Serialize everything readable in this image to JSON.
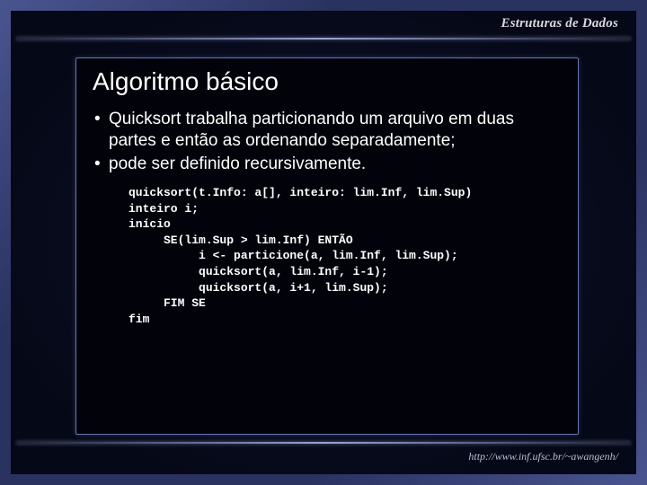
{
  "header": {
    "course": "Estruturas de Dados"
  },
  "slide": {
    "title": "Algoritmo básico",
    "bullets": [
      "Quicksort trabalha particionando um arquivo em duas partes e então as ordenando separadamente;",
      "pode ser definido recursivamente."
    ],
    "code": "quicksort(t.Info: a[], inteiro: lim.Inf, lim.Sup)\ninteiro i;\ninício\n     SE(lim.Sup > lim.Inf) ENTÃO\n          i <- particione(a, lim.Inf, lim.Sup);\n          quicksort(a, lim.Inf, i-1);\n          quicksort(a, i+1, lim.Sup);\n     FIM SE\nfim"
  },
  "footer": {
    "url": "http://www.inf.ufsc.br/~awangenh/"
  }
}
